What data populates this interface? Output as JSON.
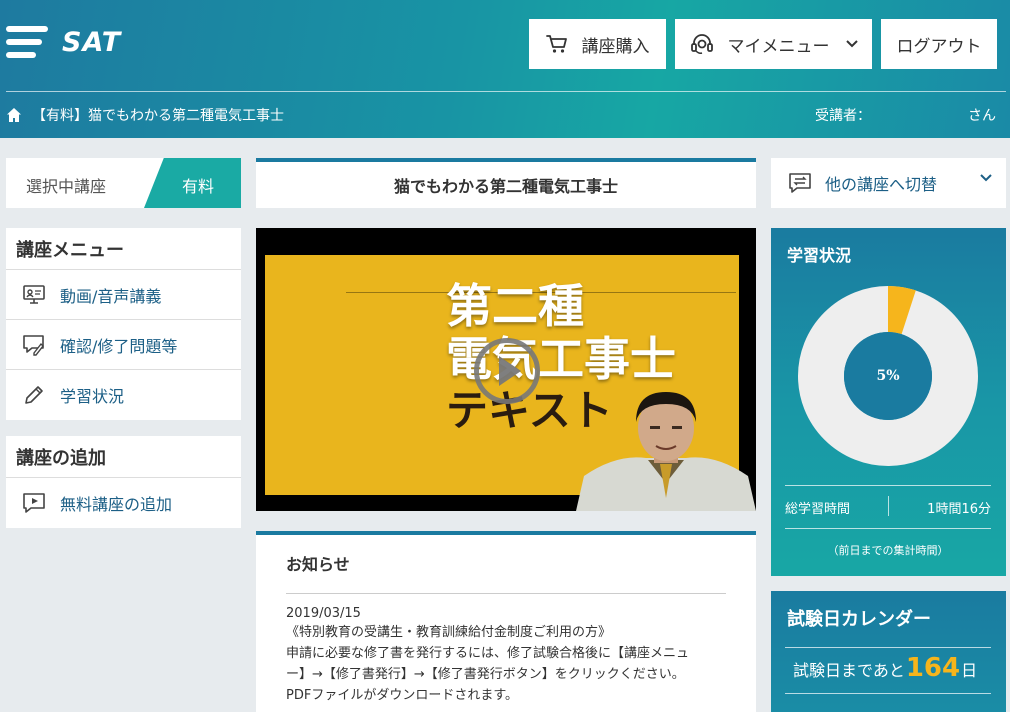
{
  "header": {
    "logo_text": "SAT",
    "buy_label": "講座購入",
    "mymenu_label": "マイメニュー",
    "logout_label": "ログアウト"
  },
  "breadcrumb": {
    "course": "【有料】猫でもわかる第二種電気工事士"
  },
  "learner": {
    "label": "受講者：",
    "suffix": "さん"
  },
  "sidebar": {
    "selected_label": "選択中講座",
    "selected_tag": "有料",
    "menu_title": "講座メニュー",
    "menu_items": [
      {
        "label": "動画/音声講義",
        "icon": "video-lecture-icon"
      },
      {
        "label": "確認/修了問題等",
        "icon": "quiz-icon"
      },
      {
        "label": "学習状況",
        "icon": "pencil-icon"
      }
    ],
    "add_title": "講座の追加",
    "add_items": [
      {
        "label": "無料講座の追加",
        "icon": "play-chat-icon"
      }
    ]
  },
  "main": {
    "course_title": "猫でもわかる第二種電気工事士",
    "video": {
      "line1": "第二種",
      "line2": "電気工事士",
      "line3": "テキスト"
    },
    "news": {
      "title": "お知らせ",
      "date": "2019/03/15",
      "lines": [
        "《特別教育の受講生・教育訓練給付金制度ご利用の方》",
        "申請に必要な修了書を発行するには、修了試験合格後に【講座メニュ",
        "ー】→【修了書発行】→【修了書発行ボタン】をクリックください。",
        "PDFファイルがダウンロードされます。"
      ]
    }
  },
  "right": {
    "switch_label": "他の講座へ切替",
    "study": {
      "title": "学習状況",
      "progress_percent": 5,
      "progress_label": "5%",
      "total_label": "総学習時間",
      "total_value": "1時間16分",
      "note": "（前日までの集計時間）"
    },
    "calendar": {
      "title": "試験日カレンダー",
      "prefix": "試験日まであと",
      "days": "164",
      "suffix": "日"
    }
  },
  "colors": {
    "header_start": "#1e7aa0",
    "header_mid": "#17a7a4",
    "teal": "#1aaaa4",
    "accent_blue": "#1a7aa0",
    "link_blue": "#1c5f86",
    "highlight_orange": "#f6b51c",
    "donut_bg": "#eeeeee"
  }
}
